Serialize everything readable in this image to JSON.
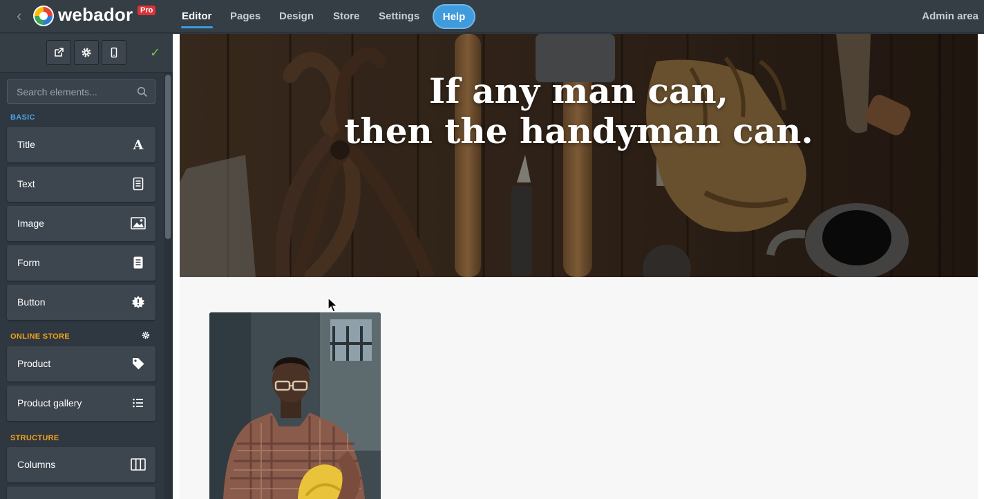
{
  "app": {
    "brand": "webador",
    "badge": "Pro"
  },
  "nav": {
    "items": [
      {
        "label": "Editor"
      },
      {
        "label": "Pages"
      },
      {
        "label": "Design"
      },
      {
        "label": "Store"
      },
      {
        "label": "Settings"
      }
    ],
    "help": "Help",
    "admin": "Admin area"
  },
  "sidebar": {
    "search_placeholder": "Search elements...",
    "sections": {
      "basic": "BASIC",
      "online_store": "ONLINE STORE",
      "structure": "STRUCTURE"
    },
    "basic_items": [
      {
        "label": "Title",
        "icon": "title-icon"
      },
      {
        "label": "Text",
        "icon": "text-icon"
      },
      {
        "label": "Image",
        "icon": "image-icon"
      },
      {
        "label": "Form",
        "icon": "form-icon"
      },
      {
        "label": "Button",
        "icon": "button-icon"
      }
    ],
    "store_items": [
      {
        "label": "Product",
        "icon": "tag-icon"
      },
      {
        "label": "Product gallery",
        "icon": "list-icon"
      }
    ],
    "structure_items": [
      {
        "label": "Columns",
        "icon": "columns-icon"
      }
    ]
  },
  "hero": {
    "line1": "If any man can,",
    "line2": "then the handyman can."
  },
  "colors": {
    "accent": "#3f9bdc",
    "basic_section": "#4ba3e0",
    "store_section": "#f0a31a",
    "pro_badge": "#d9343a",
    "check": "#7fc04a"
  }
}
